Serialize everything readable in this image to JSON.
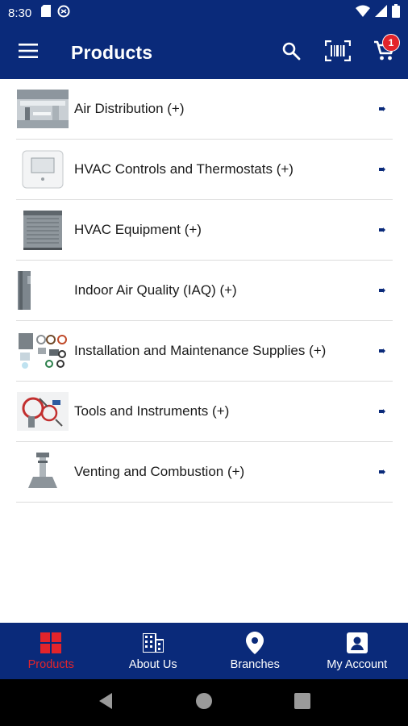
{
  "status_bar": {
    "time": "8:30"
  },
  "app_bar": {
    "title": "Products",
    "cart_badge_count": "1"
  },
  "categories": [
    {
      "label": "Air Distribution (+)",
      "thumb": "air-distribution"
    },
    {
      "label": "HVAC Controls and Thermostats (+)",
      "thumb": "thermostat"
    },
    {
      "label": "HVAC Equipment (+)",
      "thumb": "condenser"
    },
    {
      "label": "Indoor Air Quality (IAQ) (+)",
      "thumb": "air-cleaner"
    },
    {
      "label": "Installation and Maintenance Supplies (+)",
      "thumb": "supplies"
    },
    {
      "label": "Tools and Instruments (+)",
      "thumb": "tools"
    },
    {
      "label": "Venting and Combustion (+)",
      "thumb": "vent"
    }
  ],
  "bottom_nav": {
    "items": [
      {
        "label": "Products",
        "icon": "grid-icon",
        "active": true
      },
      {
        "label": "About Us",
        "icon": "building-icon",
        "active": false
      },
      {
        "label": "Branches",
        "icon": "location-pin-icon",
        "active": false
      },
      {
        "label": "My Account",
        "icon": "account-icon",
        "active": false
      }
    ]
  },
  "colors": {
    "brand_navy": "#0a2a7a",
    "accent_red": "#e3242b",
    "divider": "#dcdcdc"
  }
}
